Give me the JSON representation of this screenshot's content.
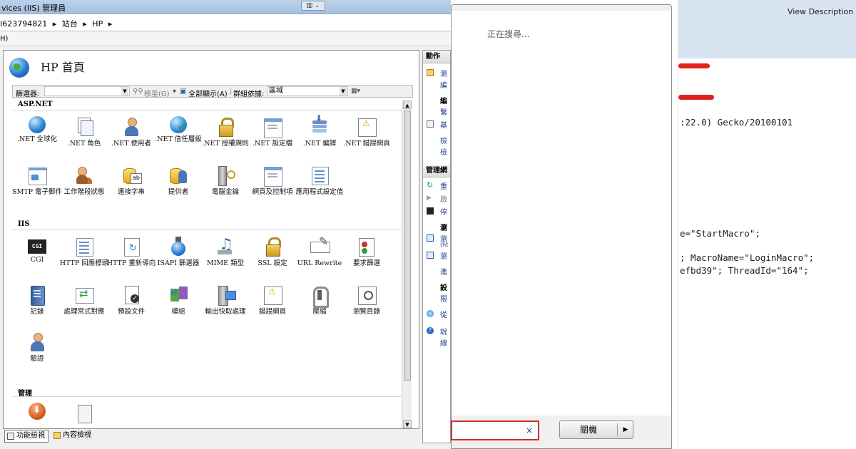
{
  "iis": {
    "title": "vices (IIS) 管理員",
    "breadcrumbs": [
      "I623794821",
      "站台",
      "HP"
    ],
    "menu": "H)",
    "page_title": "HP 首頁",
    "filter": {
      "label": "篩選器:",
      "go_label": "移至(G)",
      "show_all_label": "全部顯示(A)",
      "group_label": "群組依據:",
      "group_value": "區域"
    },
    "sections": {
      "aspnet": "ASP.NET",
      "iis": "IIS",
      "management": "管理"
    },
    "aspnet_items": [
      {
        "label": ".NET 全球化",
        "icon": "globe-icon"
      },
      {
        "label": ".NET 角色",
        "icon": "roles-icon"
      },
      {
        "label": ".NET 使用者",
        "icon": "users-icon"
      },
      {
        "label": ".NET 信任層級",
        "icon": "trust-icon"
      },
      {
        "label": ".NET 授權規則",
        "icon": "authorization-icon"
      },
      {
        "label": ".NET 設定檔",
        "icon": "profile-icon"
      },
      {
        "label": ".NET 編譯",
        "icon": "compilation-icon"
      },
      {
        "label": ".NET 錯誤網頁",
        "icon": "error-page-icon"
      },
      {
        "label": "SMTP 電子郵件",
        "icon": "smtp-icon"
      },
      {
        "label": "工作階段狀態",
        "icon": "session-state-icon"
      },
      {
        "label": "連接字串",
        "icon": "connection-string-icon"
      },
      {
        "label": "提供者",
        "icon": "providers-icon"
      },
      {
        "label": "電腦金鑰",
        "icon": "machine-key-icon"
      },
      {
        "label": "網頁及控制項",
        "icon": "pages-controls-icon"
      },
      {
        "label": "應用程式設定值",
        "icon": "app-settings-icon"
      }
    ],
    "iis_items": [
      {
        "label": "CGI",
        "icon": "cgi-icon"
      },
      {
        "label": "HTTP 回應標頭",
        "icon": "response-headers-icon"
      },
      {
        "label": "HTTP 重新導向",
        "icon": "redirect-icon"
      },
      {
        "label": "ISAPI 篩選器",
        "icon": "isapi-icon"
      },
      {
        "label": "MIME 類型",
        "icon": "mime-icon"
      },
      {
        "label": "SSL 設定",
        "icon": "ssl-icon"
      },
      {
        "label": "URL Rewrite",
        "icon": "url-rewrite-icon"
      },
      {
        "label": "要求篩選",
        "icon": "request-filtering-icon"
      },
      {
        "label": "記錄",
        "icon": "logging-icon"
      },
      {
        "label": "處理常式對應",
        "icon": "handler-mappings-icon"
      },
      {
        "label": "預設文件",
        "icon": "default-document-icon"
      },
      {
        "label": "模組",
        "icon": "modules-icon"
      },
      {
        "label": "輸出快取處理",
        "icon": "output-cache-icon"
      },
      {
        "label": "錯誤網頁",
        "icon": "error-pages-icon"
      },
      {
        "label": "壓縮",
        "icon": "compression-icon"
      },
      {
        "label": "瀏覽目錄",
        "icon": "directory-browsing-icon"
      },
      {
        "label": "驗證",
        "icon": "authentication-icon"
      }
    ],
    "cgi_text": "CGI",
    "bottom_tabs": {
      "features": "功能檢視",
      "content": "內容檢視"
    },
    "actions": {
      "header": "動作",
      "manage_header": "管理網",
      "items": [
        "瀏",
        "編",
        "編",
        "繫",
        "基",
        "檢",
        "檢",
        "重",
        "啟",
        "停",
        "瀏",
        "瀏",
        "(ht",
        "瀏",
        "進",
        "設",
        "限",
        "從",
        "說",
        "線"
      ]
    }
  },
  "dialog": {
    "status": "正在搜尋...",
    "close_label": "關機",
    "clear_glyph": "×",
    "arrow_glyph": "▶"
  },
  "log": {
    "view_description": "View Description",
    "lines": [
      ":22.0) Gecko/20100101",
      "e=\"StartMacro\";",
      "; MacroName=\"LoginMacro\";",
      "efbd39\"; ThreadId=\"164\";"
    ],
    "redact_color": "#e0231a"
  }
}
